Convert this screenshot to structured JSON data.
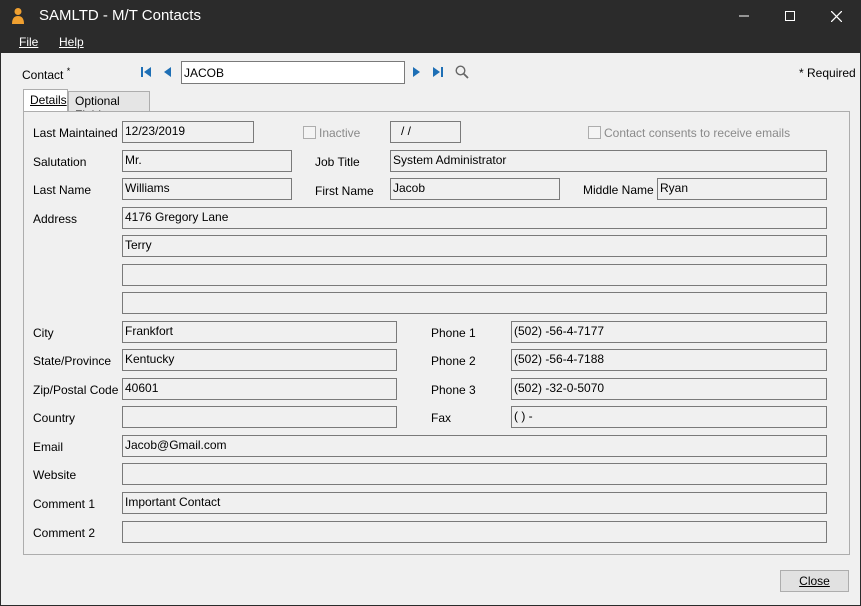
{
  "window": {
    "title": "SAMLTD - M/T Contacts",
    "minimize": "—",
    "maximize": "☐",
    "close": "✕"
  },
  "menu": {
    "file": "File",
    "help": "Help"
  },
  "header": {
    "contact_label": "Contact",
    "required_marker": "*",
    "contact_value": "JACOB",
    "required_note": "* Required"
  },
  "tabs": [
    {
      "label": "Details"
    },
    {
      "label": "Optional Fields"
    }
  ],
  "form": {
    "last_maintained_label": "Last Maintained",
    "last_maintained": "12/23/2019",
    "inactive_label": "Inactive",
    "inactive_date": " /  /",
    "consent_label": "Contact consents to receive emails",
    "salutation_label": "Salutation",
    "salutation": "Mr.",
    "job_title_label": "Job Title",
    "job_title": "System Administrator",
    "last_name_label": "Last Name",
    "last_name": "Williams",
    "first_name_label": "First Name",
    "first_name": "Jacob",
    "middle_name_label": "Middle Name",
    "middle_name": "Ryan",
    "address_label": "Address",
    "address": [
      "4176 Gregory Lane",
      "Terry",
      "",
      ""
    ],
    "city_label": "City",
    "city": "Frankfort",
    "state_label": "State/Province",
    "state": "Kentucky",
    "zip_label": "Zip/Postal Code",
    "zip": "40601",
    "country_label": "Country",
    "country": "",
    "phone1_label": "Phone 1",
    "phone1": "(502) -56-4-7177",
    "phone2_label": "Phone 2",
    "phone2": "(502) -56-4-7188",
    "phone3_label": "Phone 3",
    "phone3": "(502) -32-0-5070",
    "fax_label": "Fax",
    "fax": "(  )   -",
    "email_label": "Email",
    "email": "Jacob@Gmail.com",
    "website_label": "Website",
    "website": "",
    "comment1_label": "Comment 1",
    "comment1": "Important Contact",
    "comment2_label": "Comment 2",
    "comment2": ""
  },
  "footer": {
    "close_label": "Close"
  },
  "colors": {
    "titlebar": "#2b2b2b",
    "nav_accent": "#1e6fb5",
    "app_icon": "#f0a030"
  }
}
